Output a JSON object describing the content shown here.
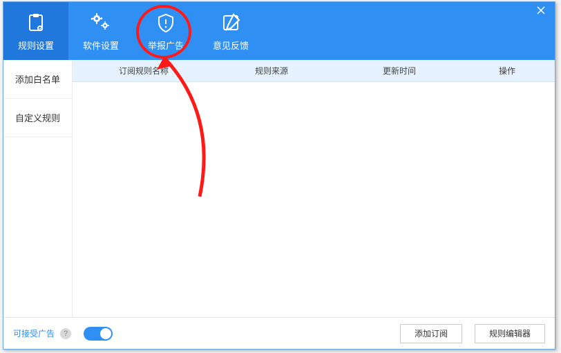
{
  "tabs": {
    "rules": {
      "label": "规则设置"
    },
    "software": {
      "label": "软件设置"
    },
    "report": {
      "label": "举报广告"
    },
    "feedback": {
      "label": "意见反馈"
    }
  },
  "sidebar": {
    "whitelist": "添加白名单",
    "custom": "自定义规则"
  },
  "table": {
    "headers": {
      "name": "订阅规则名称",
      "source": "规则来源",
      "updated": "更新时间",
      "action": "操作"
    }
  },
  "footer": {
    "acceptable_ads": "可接受广告",
    "help_badge": "?",
    "add_subscription": "添加订阅",
    "rule_editor": "规则编辑器"
  },
  "colors": {
    "primary": "#2f8ff3",
    "annotation": "#ff1a1a"
  }
}
